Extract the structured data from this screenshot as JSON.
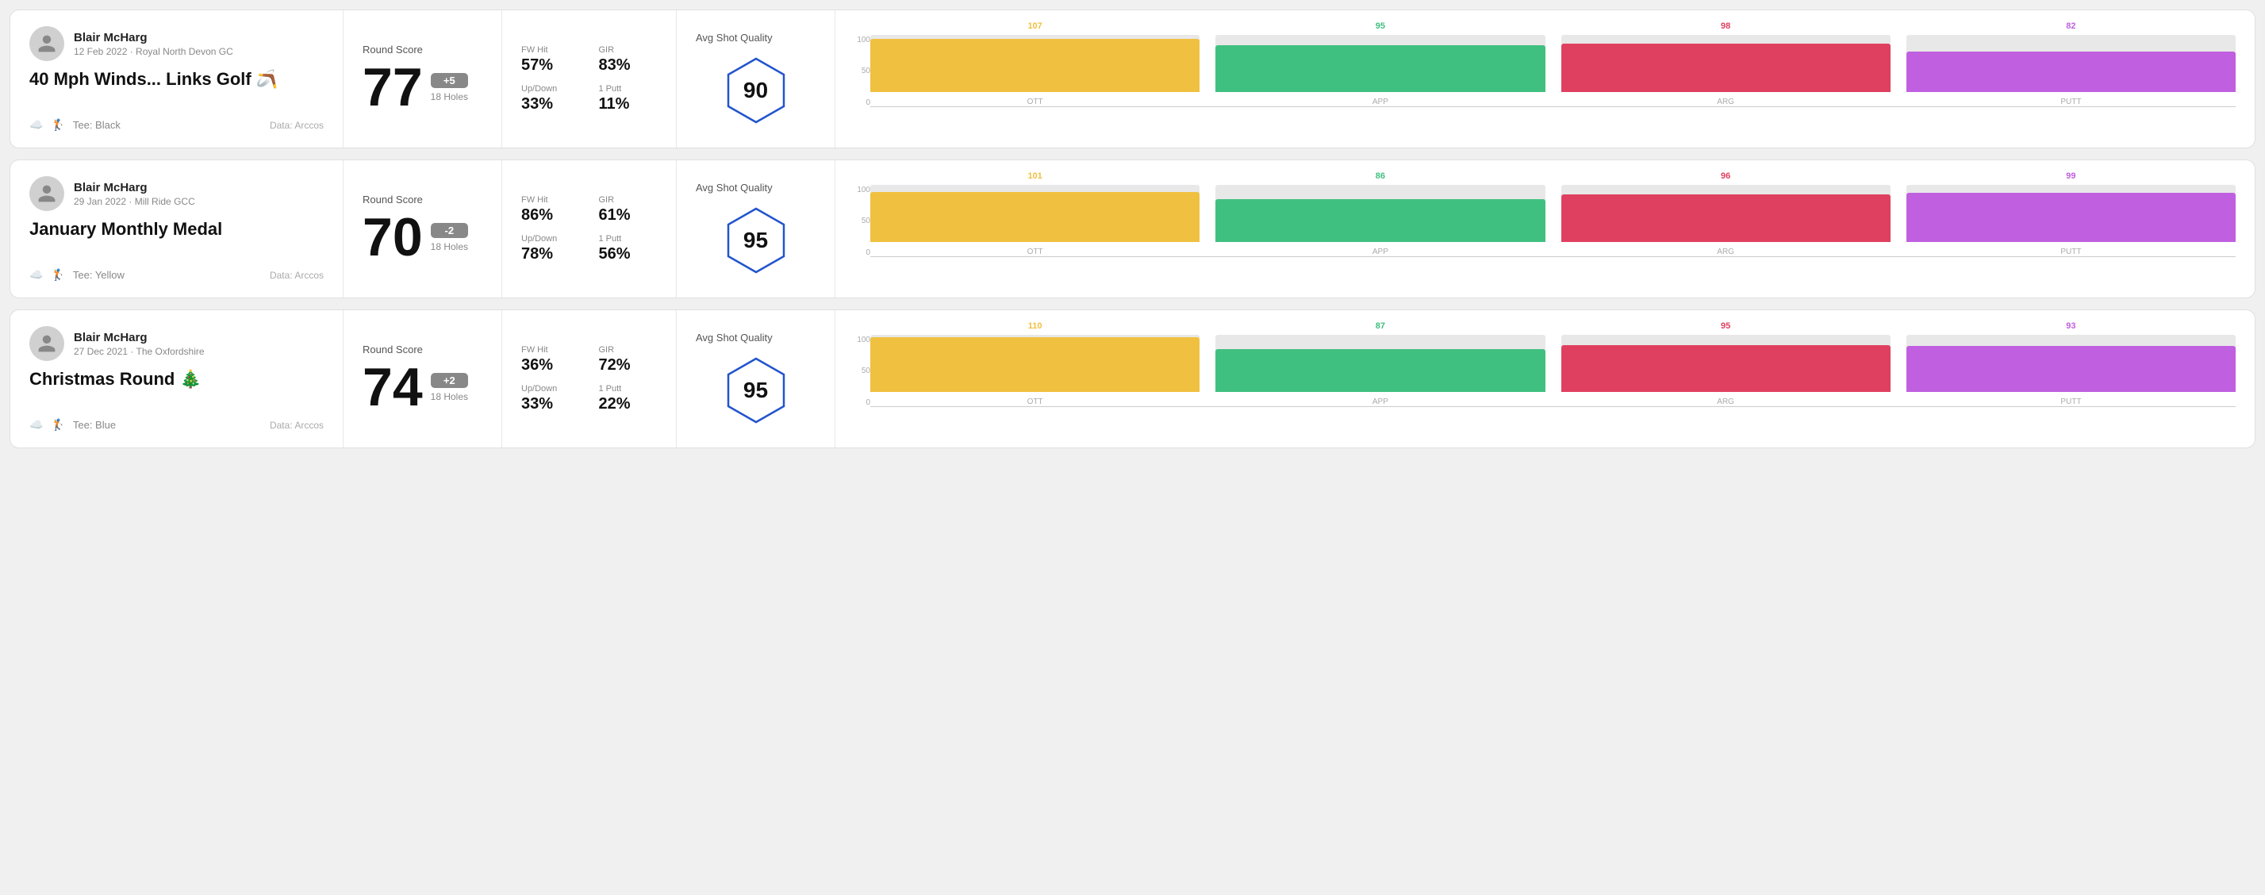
{
  "rounds": [
    {
      "id": "round1",
      "player": {
        "name": "Blair McHarg",
        "date": "12 Feb 2022 · Royal North Devon GC"
      },
      "title": "40 Mph Winds... Links Golf 🪃",
      "tee": "Tee: Black",
      "data_source": "Data: Arccos",
      "score": {
        "number": "77",
        "badge": "+5",
        "badge_type": "positive",
        "holes": "18 Holes"
      },
      "stats": {
        "fw_hit_label": "FW Hit",
        "fw_hit_value": "57%",
        "gir_label": "GIR",
        "gir_value": "83%",
        "updown_label": "Up/Down",
        "updown_value": "33%",
        "oneputt_label": "1 Putt",
        "oneputt_value": "11%"
      },
      "quality": {
        "label": "Avg Shot Quality",
        "score": "90"
      },
      "chart": {
        "bars": [
          {
            "label": "OTT",
            "value": 107,
            "color_class": "ott-bar",
            "value_color": "ott-color"
          },
          {
            "label": "APP",
            "value": 95,
            "color_class": "app-bar",
            "value_color": "app-color"
          },
          {
            "label": "ARG",
            "value": 98,
            "color_class": "arg-bar",
            "value_color": "arg-color"
          },
          {
            "label": "PUTT",
            "value": 82,
            "color_class": "putt-bar",
            "value_color": "putt-color"
          }
        ],
        "y_labels": [
          "100",
          "50",
          "0"
        ]
      }
    },
    {
      "id": "round2",
      "player": {
        "name": "Blair McHarg",
        "date": "29 Jan 2022 · Mill Ride GCC"
      },
      "title": "January Monthly Medal",
      "tee": "Tee: Yellow",
      "data_source": "Data: Arccos",
      "score": {
        "number": "70",
        "badge": "-2",
        "badge_type": "negative",
        "holes": "18 Holes"
      },
      "stats": {
        "fw_hit_label": "FW Hit",
        "fw_hit_value": "86%",
        "gir_label": "GIR",
        "gir_value": "61%",
        "updown_label": "Up/Down",
        "updown_value": "78%",
        "oneputt_label": "1 Putt",
        "oneputt_value": "56%"
      },
      "quality": {
        "label": "Avg Shot Quality",
        "score": "95"
      },
      "chart": {
        "bars": [
          {
            "label": "OTT",
            "value": 101,
            "color_class": "ott-bar",
            "value_color": "ott-color"
          },
          {
            "label": "APP",
            "value": 86,
            "color_class": "app-bar",
            "value_color": "app-color"
          },
          {
            "label": "ARG",
            "value": 96,
            "color_class": "arg-bar",
            "value_color": "arg-color"
          },
          {
            "label": "PUTT",
            "value": 99,
            "color_class": "putt-bar",
            "value_color": "putt-color"
          }
        ],
        "y_labels": [
          "100",
          "50",
          "0"
        ]
      }
    },
    {
      "id": "round3",
      "player": {
        "name": "Blair McHarg",
        "date": "27 Dec 2021 · The Oxfordshire"
      },
      "title": "Christmas Round 🎄",
      "tee": "Tee: Blue",
      "data_source": "Data: Arccos",
      "score": {
        "number": "74",
        "badge": "+2",
        "badge_type": "positive",
        "holes": "18 Holes"
      },
      "stats": {
        "fw_hit_label": "FW Hit",
        "fw_hit_value": "36%",
        "gir_label": "GIR",
        "gir_value": "72%",
        "updown_label": "Up/Down",
        "updown_value": "33%",
        "oneputt_label": "1 Putt",
        "oneputt_value": "22%"
      },
      "quality": {
        "label": "Avg Shot Quality",
        "score": "95"
      },
      "chart": {
        "bars": [
          {
            "label": "OTT",
            "value": 110,
            "color_class": "ott-bar",
            "value_color": "ott-color"
          },
          {
            "label": "APP",
            "value": 87,
            "color_class": "app-bar",
            "value_color": "app-color"
          },
          {
            "label": "ARG",
            "value": 95,
            "color_class": "arg-bar",
            "value_color": "arg-color"
          },
          {
            "label": "PUTT",
            "value": 93,
            "color_class": "putt-bar",
            "value_color": "putt-color"
          }
        ],
        "y_labels": [
          "100",
          "50",
          "0"
        ]
      }
    }
  ],
  "labels": {
    "round_score": "Round Score",
    "avg_shot_quality": "Avg Shot Quality",
    "fw_hit": "FW Hit",
    "gir": "GIR",
    "up_down": "Up/Down",
    "one_putt": "1 Putt",
    "data_prefix": "Data: Arccos"
  }
}
